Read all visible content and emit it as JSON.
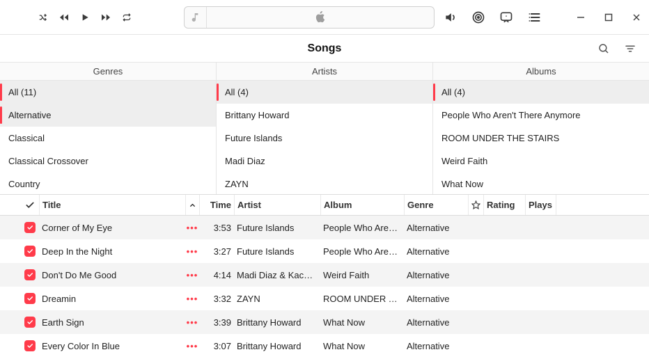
{
  "view": {
    "title": "Songs"
  },
  "browser": {
    "cols": [
      {
        "header": "Genres",
        "items": [
          {
            "label": "All (11)",
            "selected": true
          },
          {
            "label": "Alternative",
            "selected": true
          },
          {
            "label": "Classical",
            "selected": false
          },
          {
            "label": "Classical Crossover",
            "selected": false
          },
          {
            "label": "Country",
            "selected": false
          }
        ]
      },
      {
        "header": "Artists",
        "items": [
          {
            "label": "All (4)",
            "selected": true
          },
          {
            "label": "Brittany Howard",
            "selected": false
          },
          {
            "label": "Future Islands",
            "selected": false
          },
          {
            "label": "Madi Diaz",
            "selected": false
          },
          {
            "label": "ZAYN",
            "selected": false
          }
        ]
      },
      {
        "header": "Albums",
        "items": [
          {
            "label": "All (4)",
            "selected": true
          },
          {
            "label": "People Who Aren't There Anymore",
            "selected": false
          },
          {
            "label": "ROOM UNDER THE STAIRS",
            "selected": false
          },
          {
            "label": "Weird Faith",
            "selected": false
          },
          {
            "label": "What Now",
            "selected": false
          }
        ]
      }
    ]
  },
  "table": {
    "headers": {
      "title": "Title",
      "time": "Time",
      "artist": "Artist",
      "album": "Album",
      "genre": "Genre",
      "rating": "Rating",
      "plays": "Plays"
    },
    "rows": [
      {
        "checked": true,
        "title": "Corner of My Eye",
        "time": "3:53",
        "artist": "Future Islands",
        "album": "People Who Aren't T…",
        "genre": "Alternative"
      },
      {
        "checked": true,
        "title": "Deep In the Night",
        "time": "3:27",
        "artist": "Future Islands",
        "album": "People Who Aren't T…",
        "genre": "Alternative"
      },
      {
        "checked": true,
        "title": "Don't Do Me Good",
        "time": "4:14",
        "artist": "Madi Diaz & Kacey…",
        "album": "Weird Faith",
        "genre": "Alternative"
      },
      {
        "checked": true,
        "title": "Dreamin",
        "time": "3:32",
        "artist": "ZAYN",
        "album": "ROOM UNDER THE…",
        "genre": "Alternative"
      },
      {
        "checked": true,
        "title": "Earth Sign",
        "time": "3:39",
        "artist": "Brittany Howard",
        "album": "What Now",
        "genre": "Alternative"
      },
      {
        "checked": true,
        "title": "Every Color In Blue",
        "time": "3:07",
        "artist": "Brittany Howard",
        "album": "What Now",
        "genre": "Alternative"
      }
    ]
  },
  "icons": {
    "more": "•••"
  }
}
